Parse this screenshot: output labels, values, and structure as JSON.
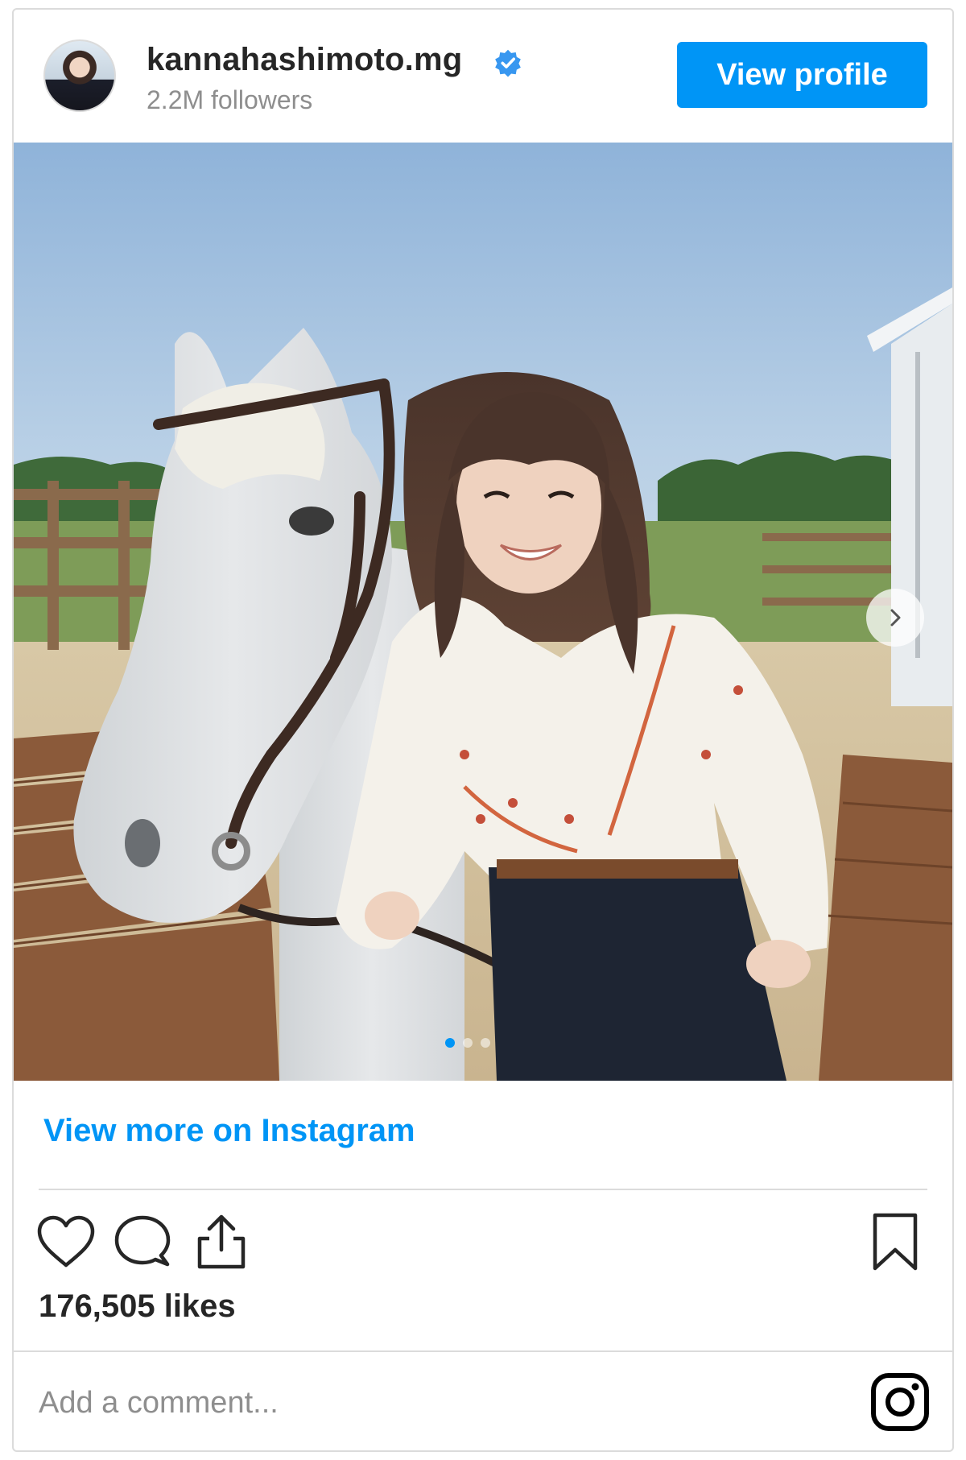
{
  "header": {
    "username": "kannahashimoto.mg",
    "followers": "2.2M followers",
    "view_profile_label": "View profile"
  },
  "media": {
    "carousel_dots": 3,
    "active_dot": 0
  },
  "footer": {
    "view_more_label": "View more on Instagram",
    "likes": "176,505 likes",
    "comment_placeholder": "Add a comment..."
  },
  "icons": {
    "verified": "verified-badge-icon",
    "like": "heart-icon",
    "comment": "comment-bubble-icon",
    "share": "share-icon",
    "save": "bookmark-icon",
    "next": "chevron-right-icon",
    "logo": "instagram-logo-icon"
  },
  "colors": {
    "accent": "#0095f6",
    "text": "#262626",
    "muted": "#8e8e8e",
    "border": "#dbdbdb"
  }
}
